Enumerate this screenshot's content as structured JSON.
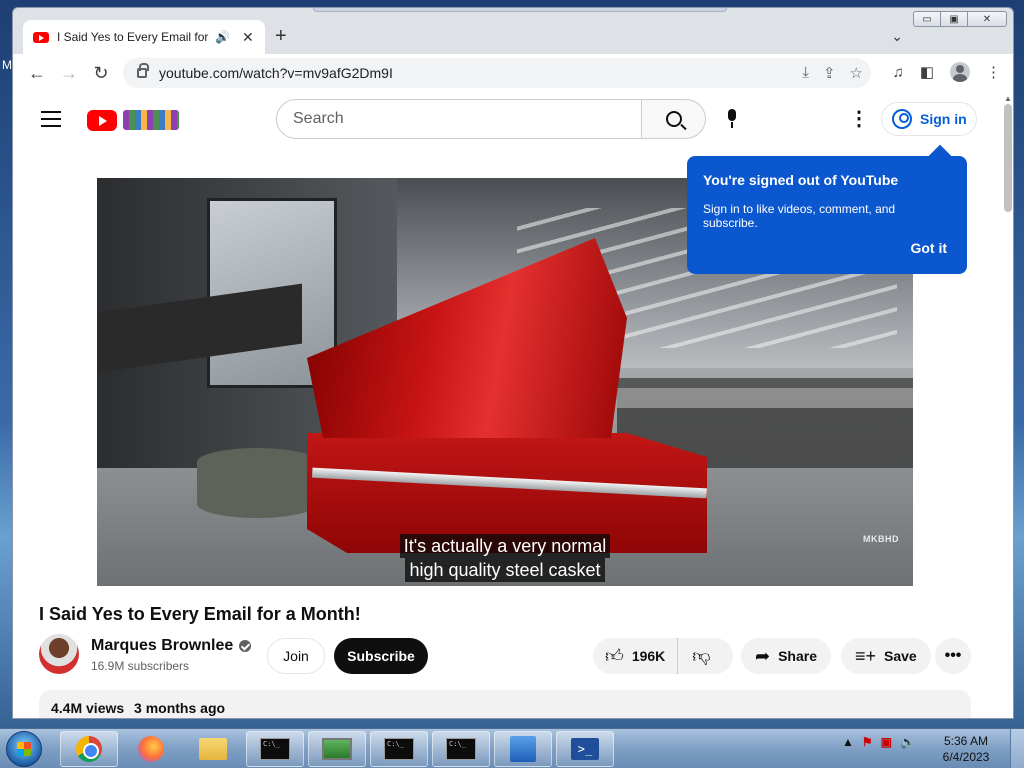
{
  "browser": {
    "tab_title": "I Said Yes to Every Email for a Month! - YouTube",
    "tab_audio_icon": "speaker-icon",
    "url": "youtube.com/watch?v=mv9afG2Dm9I",
    "window_controls": {
      "minimize": "▭",
      "maximize": "▣",
      "close": "✕"
    }
  },
  "youtube": {
    "search_placeholder": "Search",
    "sign_in_label": "Sign in",
    "tooltip": {
      "title": "You're signed out of YouTube",
      "body": "Sign in to like videos, comment, and subscribe.",
      "button": "Got it"
    },
    "video": {
      "caption_line1": "It's actually a very normal",
      "caption_line2": "high quality steel casket",
      "watermark": "MKBHD"
    },
    "title": "I Said Yes to Every Email for a Month!",
    "channel": {
      "name": "Marques Brownlee",
      "subscribers": "16.9M subscribers"
    },
    "buttons": {
      "join": "Join",
      "subscribe": "Subscribe",
      "likes": "196K",
      "share": "Share",
      "save": "Save",
      "more": "•••"
    },
    "description": {
      "views": "4.4M views",
      "age": "3 months ago"
    }
  },
  "taskbar": {
    "time": "5:36 AM",
    "date": "6/4/2023",
    "items": [
      "chrome",
      "firefox",
      "file-explorer",
      "cmd",
      "monitor",
      "cmd",
      "cmd",
      "task-manager",
      "powershell"
    ]
  },
  "desktop": {
    "edge_letter": "M"
  }
}
